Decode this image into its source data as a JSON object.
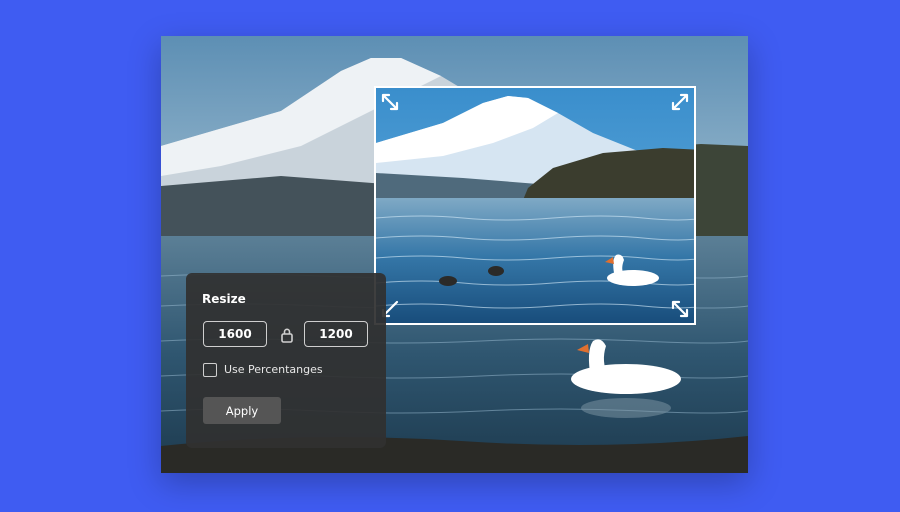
{
  "resize_panel": {
    "title": "Resize",
    "width_value": "1600",
    "height_value": "1200",
    "use_percentages_label": "Use Percentanges",
    "use_percentages_checked": false,
    "apply_label": "Apply"
  },
  "icons": {
    "lock": "lock-icon",
    "resize_handles": "expand-arrow-icon"
  },
  "colors": {
    "background": "#3f5cf2",
    "panel": "#303030",
    "crop_border": "#ffffff"
  }
}
